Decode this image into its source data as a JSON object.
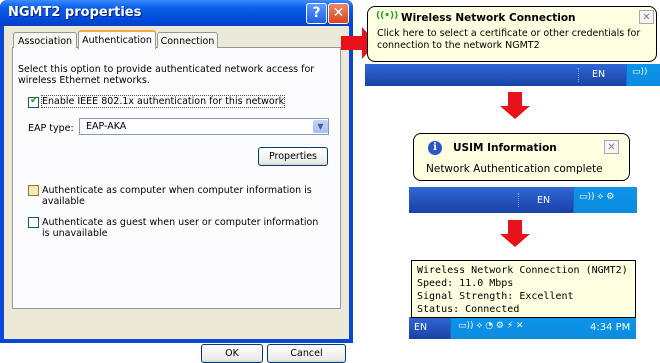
{
  "dialog": {
    "title": "NGMT2 properties",
    "help_glyph": "?",
    "close_glyph": "✕",
    "tabs": [
      "Association",
      "Authentication",
      "Connection"
    ],
    "description": "Select this option to provide authenticated network access for wireless Ethernet networks.",
    "enable_8021x": {
      "label": "Enable IEEE 802.1x authentication for this network",
      "checked": true
    },
    "eap_type_label": "EAP type:",
    "eap_type_value": "EAP-AKA",
    "properties_button": "Properties",
    "auth_as_computer": {
      "label": "Authenticate as computer when computer information is available",
      "checked": false
    },
    "auth_as_guest": {
      "label": "Authenticate as guest when user or computer information is unavailable",
      "checked": false
    },
    "ok_button": "OK",
    "cancel_button": "Cancel"
  },
  "balloon_wireless": {
    "title": "Wireless Network Connection",
    "icon_glyph": "((•))",
    "close_glyph": "✕",
    "text": "Click here to select a certificate or other credentials for connection to the network NGMT2",
    "tray_lang": "EN"
  },
  "balloon_usim": {
    "title": "USIM Information",
    "icon_glyph": "i",
    "close_glyph": "✕",
    "text": "Network Authentication complete",
    "tray_lang": "EN"
  },
  "tooltip_status": {
    "lines": [
      "Wireless Network Connection (NGMT2)",
      "Speed: 11.0 Mbps",
      "Signal Strength: Excellent",
      "Status: Connected"
    ],
    "tray_lang": "EN",
    "clock": "4:34 PM"
  },
  "colors": {
    "xp_blue": "#0a47d6",
    "arrow_red": "#e8121a",
    "balloon_bg": "#ffffe1",
    "taskbar_blue": "#1941a5"
  }
}
